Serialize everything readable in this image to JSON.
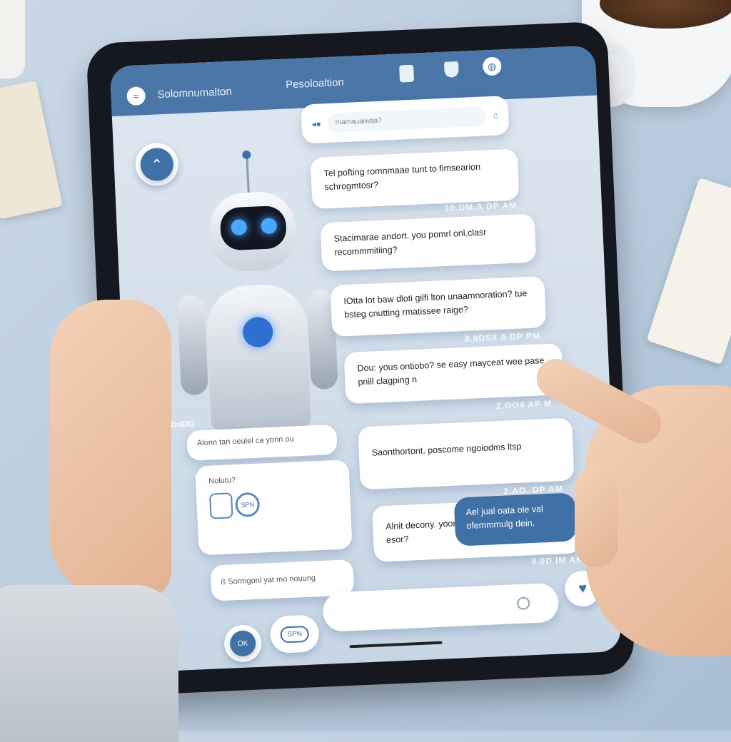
{
  "header": {
    "left_title": "Solomnumalton",
    "center_title": "Pesoloaltion",
    "icons": [
      "wifi-icon",
      "card-icon",
      "shield-icon",
      "globe-icon"
    ]
  },
  "search": {
    "placeholder": "mamauaiwaa?"
  },
  "robot_label": "ODnEIO",
  "left_cards": [
    {
      "text": "Alonn tan oeulel ca yonn ou"
    },
    {
      "title": "Nolutu?",
      "icon_text": "SPN"
    },
    {
      "text": "Sormgonl yat mo nouung"
    }
  ],
  "messages": [
    {
      "text": "Tel pofting romnmaae tunt to fimsearion schrogmtosr?",
      "time": "10.DM.A DP AM"
    },
    {
      "text": "Stacimarae andort. you pomrl onl.clasr recommmitiing?",
      "time": ""
    },
    {
      "text": "IOtta lot baw dloti gilfi lton unaamnoration? tue bsteg cnutting rmatissee raige?",
      "time": "8.9DS8 A DP PM"
    },
    {
      "text": "Dou: yous ontiobo? se easy mayceat wee pase pnill clagping n",
      "time": "2.OO4 AP M"
    },
    {
      "text": "Saonthortont. poscome ngoiodms ltsp",
      "time": "2.AO. DP AM"
    },
    {
      "text": "Alnit decony. yoonw esor?",
      "reply": "Ael jual oata ole val ofemmmulg dein.",
      "time": "8.0D IM AM"
    }
  ],
  "bottom": {
    "button1": "OK",
    "button2": "SPN"
  },
  "colors": {
    "accent": "#4a76a8",
    "background": "#c9d8e6"
  }
}
